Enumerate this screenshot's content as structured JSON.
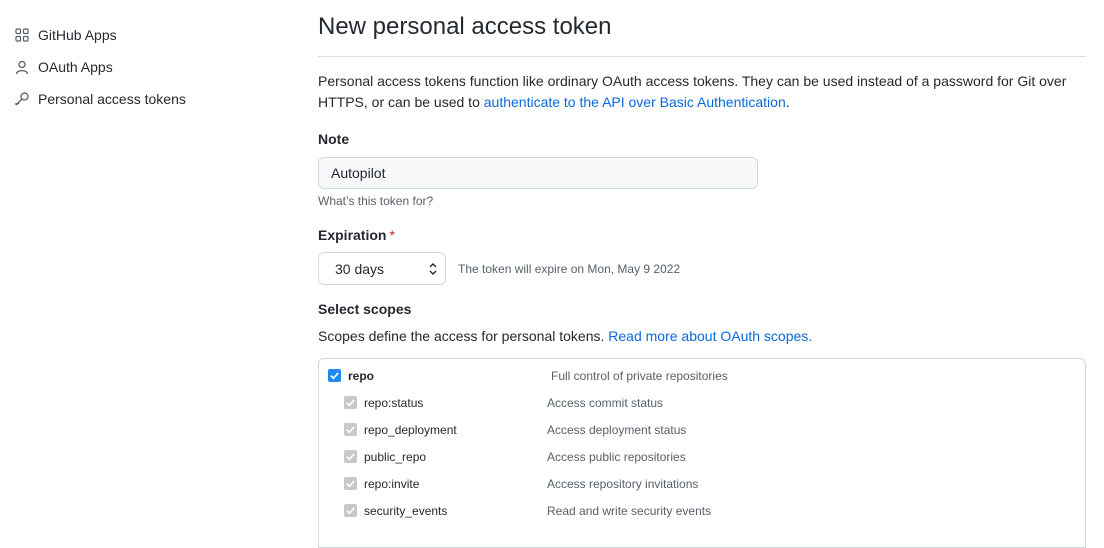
{
  "sidebar": {
    "items": [
      {
        "label": "GitHub Apps",
        "icon": "apps-grid-icon"
      },
      {
        "label": "OAuth Apps",
        "icon": "person-icon"
      },
      {
        "label": "Personal access tokens",
        "icon": "key-icon"
      }
    ]
  },
  "page": {
    "title": "New personal access token",
    "description_text": "Personal access tokens function like ordinary OAuth access tokens. They can be used instead of a password for Git over HTTPS, or can be used to ",
    "description_link": "authenticate to the API over Basic Authentication",
    "description_end": "."
  },
  "note": {
    "label": "Note",
    "value": "Autopilot",
    "hint": "What’s this token for?"
  },
  "expiration": {
    "label": "Expiration",
    "required_mark": "*",
    "selected": "30 days",
    "note": "The token will expire on Mon, May 9 2022"
  },
  "scopes": {
    "label": "Select scopes",
    "description": "Scopes define the access for personal tokens. ",
    "link": "Read more about OAuth scopes.",
    "items": [
      {
        "name": "repo",
        "description": "Full control of private repositories",
        "checked": true,
        "level": "primary"
      },
      {
        "name": "repo:status",
        "description": "Access commit status",
        "checked": true,
        "level": "sub"
      },
      {
        "name": "repo_deployment",
        "description": "Access deployment status",
        "checked": true,
        "level": "sub"
      },
      {
        "name": "public_repo",
        "description": "Access public repositories",
        "checked": true,
        "level": "sub"
      },
      {
        "name": "repo:invite",
        "description": "Access repository invitations",
        "checked": true,
        "level": "sub"
      },
      {
        "name": "security_events",
        "description": "Read and write security events",
        "checked": true,
        "level": "sub"
      }
    ]
  },
  "colors": {
    "link": "#0969da",
    "checkbox_primary": "#1f8bf0",
    "checkbox_sub": "#c6c8ca",
    "required": "#cf222e"
  }
}
